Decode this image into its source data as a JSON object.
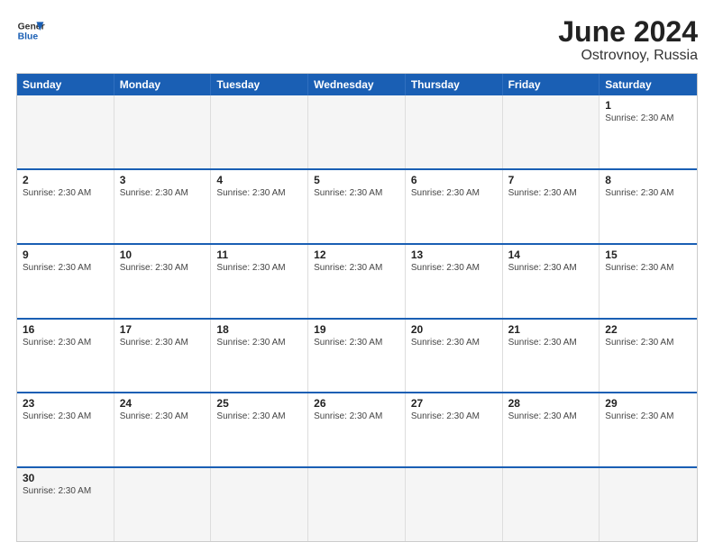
{
  "logo": {
    "line1": "General",
    "line2": "Blue"
  },
  "title": "June 2024",
  "subtitle": "Ostrovnoy, Russia",
  "headers": [
    "Sunday",
    "Monday",
    "Tuesday",
    "Wednesday",
    "Thursday",
    "Friday",
    "Saturday"
  ],
  "sunrise": "Sunrise: 2:30 AM",
  "weeks": [
    [
      {
        "day": "",
        "info": "",
        "empty": true
      },
      {
        "day": "",
        "info": "",
        "empty": true
      },
      {
        "day": "",
        "info": "",
        "empty": true
      },
      {
        "day": "",
        "info": "",
        "empty": true
      },
      {
        "day": "",
        "info": "",
        "empty": true
      },
      {
        "day": "",
        "info": "",
        "empty": true
      },
      {
        "day": "1",
        "info": "Sunrise: 2:30 AM",
        "empty": false
      }
    ],
    [
      {
        "day": "2",
        "info": "Sunrise: 2:30 AM",
        "empty": false
      },
      {
        "day": "3",
        "info": "Sunrise: 2:30 AM",
        "empty": false
      },
      {
        "day": "4",
        "info": "Sunrise: 2:30 AM",
        "empty": false
      },
      {
        "day": "5",
        "info": "Sunrise: 2:30 AM",
        "empty": false
      },
      {
        "day": "6",
        "info": "Sunrise: 2:30 AM",
        "empty": false
      },
      {
        "day": "7",
        "info": "Sunrise: 2:30 AM",
        "empty": false
      },
      {
        "day": "8",
        "info": "Sunrise: 2:30 AM",
        "empty": false
      }
    ],
    [
      {
        "day": "9",
        "info": "Sunrise: 2:30 AM",
        "empty": false
      },
      {
        "day": "10",
        "info": "Sunrise: 2:30 AM",
        "empty": false
      },
      {
        "day": "11",
        "info": "Sunrise: 2:30 AM",
        "empty": false
      },
      {
        "day": "12",
        "info": "Sunrise: 2:30 AM",
        "empty": false
      },
      {
        "day": "13",
        "info": "Sunrise: 2:30 AM",
        "empty": false
      },
      {
        "day": "14",
        "info": "Sunrise: 2:30 AM",
        "empty": false
      },
      {
        "day": "15",
        "info": "Sunrise: 2:30 AM",
        "empty": false
      }
    ],
    [
      {
        "day": "16",
        "info": "Sunrise: 2:30 AM",
        "empty": false
      },
      {
        "day": "17",
        "info": "Sunrise: 2:30 AM",
        "empty": false
      },
      {
        "day": "18",
        "info": "Sunrise: 2:30 AM",
        "empty": false
      },
      {
        "day": "19",
        "info": "Sunrise: 2:30 AM",
        "empty": false
      },
      {
        "day": "20",
        "info": "Sunrise: 2:30 AM",
        "empty": false
      },
      {
        "day": "21",
        "info": "Sunrise: 2:30 AM",
        "empty": false
      },
      {
        "day": "22",
        "info": "Sunrise: 2:30 AM",
        "empty": false
      }
    ],
    [
      {
        "day": "23",
        "info": "Sunrise: 2:30 AM",
        "empty": false
      },
      {
        "day": "24",
        "info": "Sunrise: 2:30 AM",
        "empty": false
      },
      {
        "day": "25",
        "info": "Sunrise: 2:30 AM",
        "empty": false
      },
      {
        "day": "26",
        "info": "Sunrise: 2:30 AM",
        "empty": false
      },
      {
        "day": "27",
        "info": "Sunrise: 2:30 AM",
        "empty": false
      },
      {
        "day": "28",
        "info": "Sunrise: 2:30 AM",
        "empty": false
      },
      {
        "day": "29",
        "info": "Sunrise: 2:30 AM",
        "empty": false
      }
    ],
    [
      {
        "day": "30",
        "info": "Sunrise: 2:30 AM",
        "empty": false,
        "last": true
      },
      {
        "day": "",
        "info": "",
        "empty": true,
        "last": true
      },
      {
        "day": "",
        "info": "",
        "empty": true,
        "last": true
      },
      {
        "day": "",
        "info": "",
        "empty": true,
        "last": true
      },
      {
        "day": "",
        "info": "",
        "empty": true,
        "last": true
      },
      {
        "day": "",
        "info": "",
        "empty": true,
        "last": true
      },
      {
        "day": "",
        "info": "",
        "empty": true,
        "last": true
      }
    ]
  ]
}
